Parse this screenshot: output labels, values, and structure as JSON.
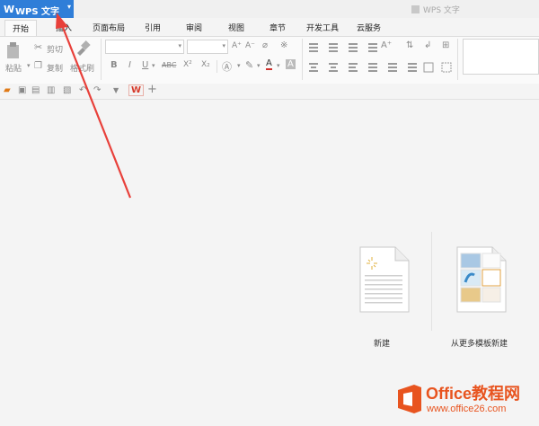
{
  "app": {
    "button_label": "WPS 文字",
    "window_title": "WPS 文字"
  },
  "tabs": [
    "开始",
    "插入",
    "页面布局",
    "引用",
    "审阅",
    "视图",
    "章节",
    "开发工具",
    "云服务"
  ],
  "ribbon": {
    "paste": "粘贴",
    "cut": "剪切",
    "copy": "复制",
    "format_painter": "格式刷",
    "bold": "B",
    "italic": "I",
    "underline": "U",
    "strike": "ABC",
    "superscript": "X²",
    "subscript": "X₂",
    "font_color": "A",
    "highlight": "A",
    "grow_font": "A⁺",
    "shrink_font": "A⁻"
  },
  "quick_access": [
    "open",
    "save",
    "save-as",
    "print",
    "undo",
    "redo",
    "dropdown",
    "wps-logo",
    "new-tab"
  ],
  "new_tab": {
    "items": [
      {
        "label": "新建"
      },
      {
        "label": "从更多模板新建"
      }
    ]
  },
  "watermark": {
    "brand": "Office教程网",
    "url": "www.office26.com"
  },
  "colors": {
    "accent": "#2f7ed8",
    "arrow": "#e8403a",
    "brand_orange": "#e8541f"
  }
}
